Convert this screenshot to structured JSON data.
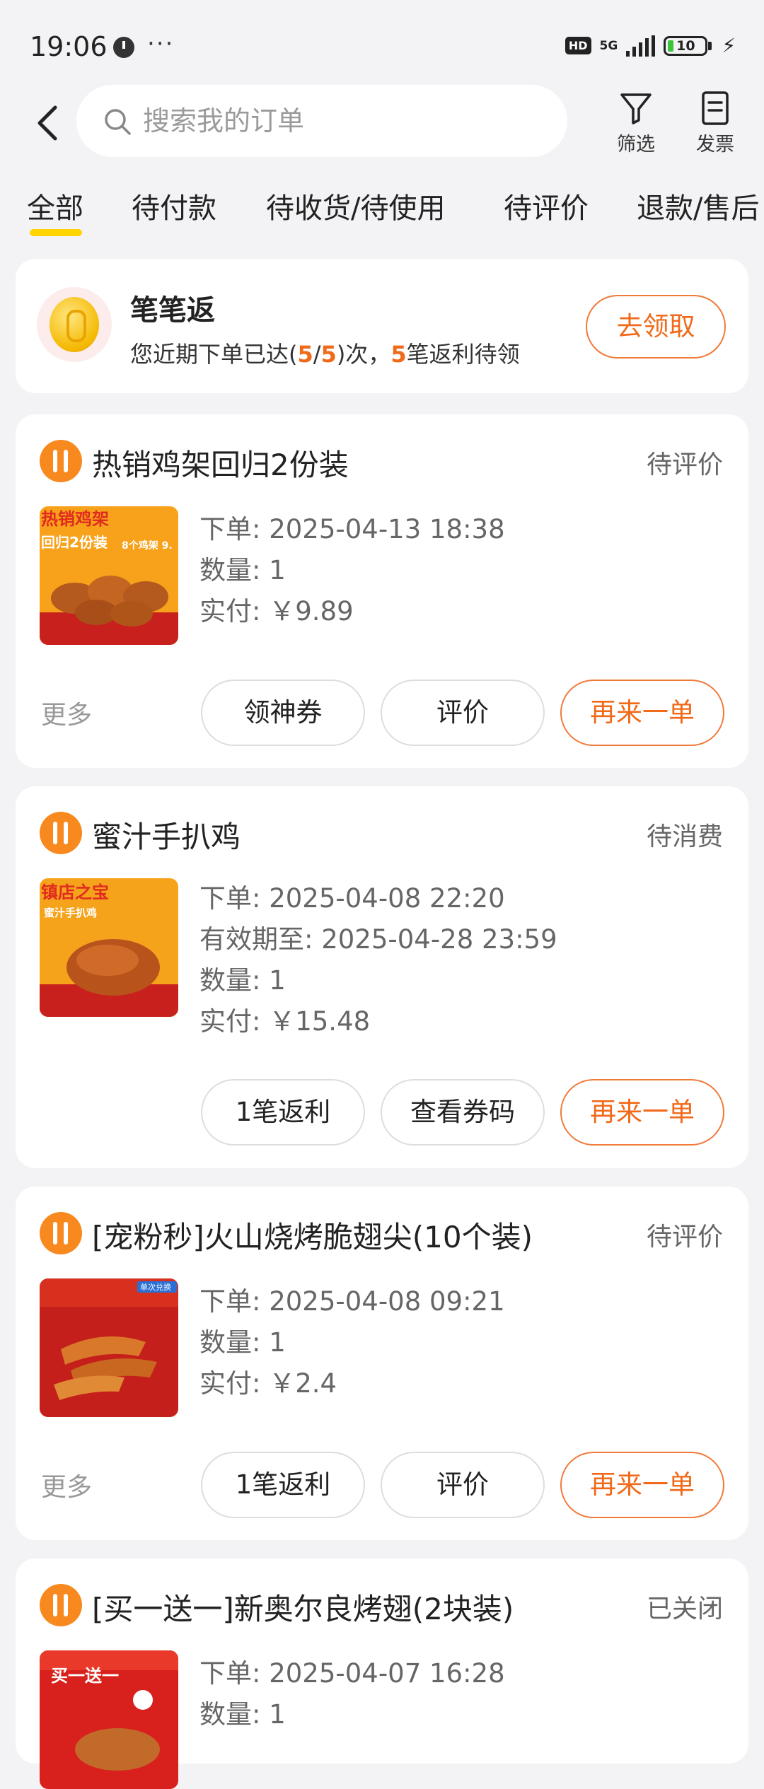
{
  "status_bar": {
    "time": "19:06",
    "dots": "···",
    "hd": "HD",
    "network": "5G",
    "battery": "10"
  },
  "header": {
    "search_placeholder": "搜索我的订单",
    "filter_label": "筛选",
    "invoice_label": "发票"
  },
  "tabs": [
    "全部",
    "待付款",
    "待收货/待使用",
    "待评价",
    "退款/售后"
  ],
  "active_tab": "全部",
  "promo": {
    "title": "笔笔返",
    "desc_prefix": "您近期下单已达(",
    "count_done": "5",
    "slash": "/",
    "count_total": "5",
    "desc_mid": ")次，",
    "rebate_count": "5",
    "desc_suffix": "笔返利待领",
    "button": "去领取"
  },
  "orders": [
    {
      "title": "热销鸡架回归2份装",
      "status": "待评价",
      "meta": [
        "下单: 2025-04-13 18:38",
        "数量: 1",
        "实付: ￥9.89"
      ],
      "more": "更多",
      "buttons": [
        "领神券",
        "评价",
        "再来一单"
      ],
      "thumb_text": [
        "热销鸡架",
        "回归2份装",
        "8个鸡架 9."
      ]
    },
    {
      "title": "蜜汁手扒鸡",
      "status": "待消费",
      "meta": [
        "下单: 2025-04-08 22:20",
        "有效期至: 2025-04-28 23:59",
        "数量: 1",
        "实付: ￥15.48"
      ],
      "more": "",
      "buttons": [
        "1笔返利",
        "查看券码",
        "再来一单"
      ],
      "thumb_text": [
        "镇店之宝",
        "蜜汁手扒鸡"
      ]
    },
    {
      "title": "[宠粉秒]火山烧烤脆翅尖(10个装)",
      "status": "待评价",
      "meta": [
        "下单: 2025-04-08 09:21",
        "数量: 1",
        "实付: ￥2.4"
      ],
      "more": "更多",
      "buttons": [
        "1笔返利",
        "评价",
        "再来一单"
      ],
      "thumb_text": [
        "单次兑换"
      ]
    },
    {
      "title": "[买一送一]新奥尔良烤翅(2块装)",
      "status": "已关闭",
      "meta": [
        "下单: 2025-04-07 16:28",
        "数量: 1"
      ],
      "thumb_text": [
        "买一送一"
      ]
    }
  ],
  "colors": {
    "accent": "#f06a1a",
    "tab_underline": "#ffd400",
    "shop_icon": "#f7891f"
  }
}
